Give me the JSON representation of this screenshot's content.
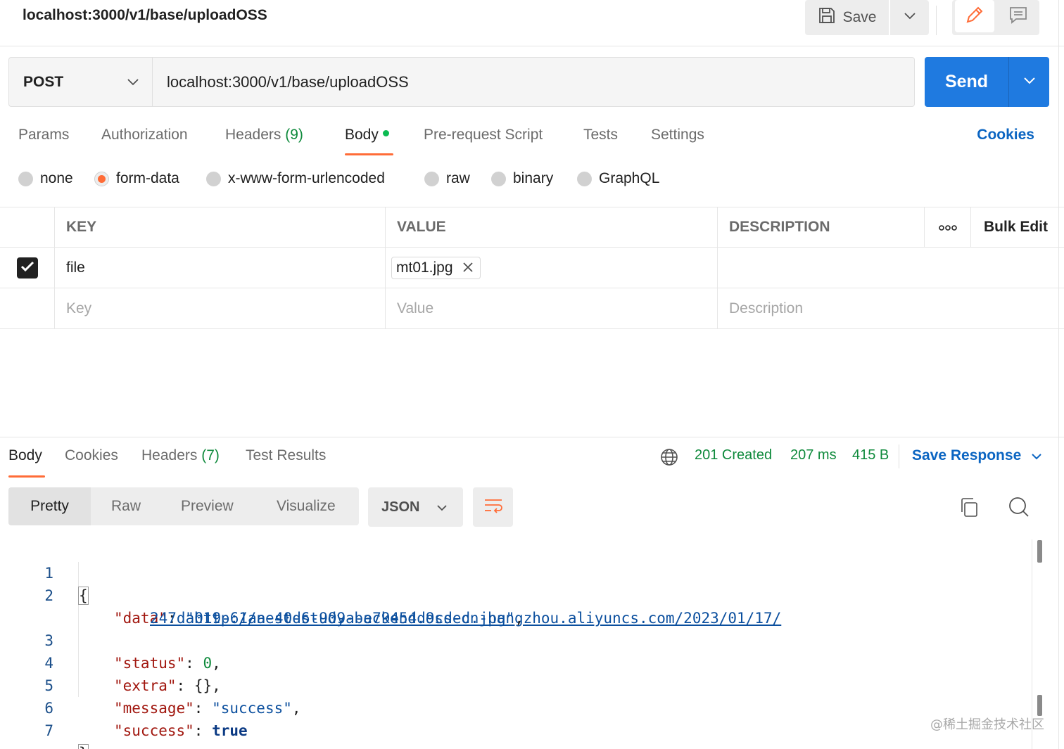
{
  "request": {
    "title": "localhost:3000/v1/base/uploadOSS",
    "save_label": "Save",
    "method": "POST",
    "url": "localhost:3000/v1/base/uploadOSS",
    "send_label": "Send"
  },
  "request_tabs": {
    "params": "Params",
    "authorization": "Authorization",
    "headers": "Headers",
    "headers_count": "(9)",
    "body": "Body",
    "prerequest": "Pre-request Script",
    "tests": "Tests",
    "settings": "Settings",
    "cookies": "Cookies"
  },
  "body_types": {
    "none": "none",
    "form_data": "form-data",
    "urlencoded": "x-www-form-urlencoded",
    "raw": "raw",
    "binary": "binary",
    "graphql": "GraphQL",
    "selected": "form-data"
  },
  "params_table": {
    "headers": {
      "key": "KEY",
      "value": "VALUE",
      "description": "DESCRIPTION",
      "bulk_edit": "Bulk Edit"
    },
    "rows": [
      {
        "checked": true,
        "key": "file",
        "value": "mt01.jpg",
        "description": ""
      }
    ],
    "placeholders": {
      "key": "Key",
      "value": "Value",
      "description": "Description"
    }
  },
  "response": {
    "tabs": {
      "body": "Body",
      "cookies": "Cookies",
      "headers": "Headers",
      "headers_count": "(7)",
      "test_results": "Test Results"
    },
    "status": "201 Created",
    "time": "207 ms",
    "size": "415 B",
    "save_response": "Save Response",
    "views": {
      "pretty": "Pretty",
      "raw": "Raw",
      "preview": "Preview",
      "visualize": "Visualize"
    },
    "format": "JSON",
    "code": {
      "line_numbers": [
        "1",
        "2",
        "3",
        "4",
        "5",
        "6",
        "7"
      ],
      "open_brace": "{",
      "close_brace": "}",
      "data_key": "\"data\"",
      "data_url_part1": "http://nest-study-backend.oss-cn-hangzhou.aliyuncs.com/2023/01/17/",
      "data_url_part2": "247da019-61aa-40d6-909a-e79454d9cded.jpg",
      "status_key": "\"status\"",
      "status_value": "0",
      "extra_key": "\"extra\"",
      "extra_value": "{}",
      "message_key": "\"message\"",
      "message_value": "\"success\"",
      "success_key": "\"success\"",
      "success_value": "true"
    }
  },
  "watermark": "@稀土掘金技术社区",
  "colors": {
    "accent_orange": "#ff6c37",
    "send_blue": "#1f7ae0",
    "link_blue": "#0b65c2",
    "status_green": "#0f8a3c"
  },
  "icons": [
    "save-icon",
    "chevron-down-icon",
    "pencil-icon",
    "comment-icon",
    "check-icon",
    "close-icon",
    "more-icon",
    "globe-icon",
    "wrap-lines-icon",
    "copy-icon",
    "search-icon"
  ]
}
